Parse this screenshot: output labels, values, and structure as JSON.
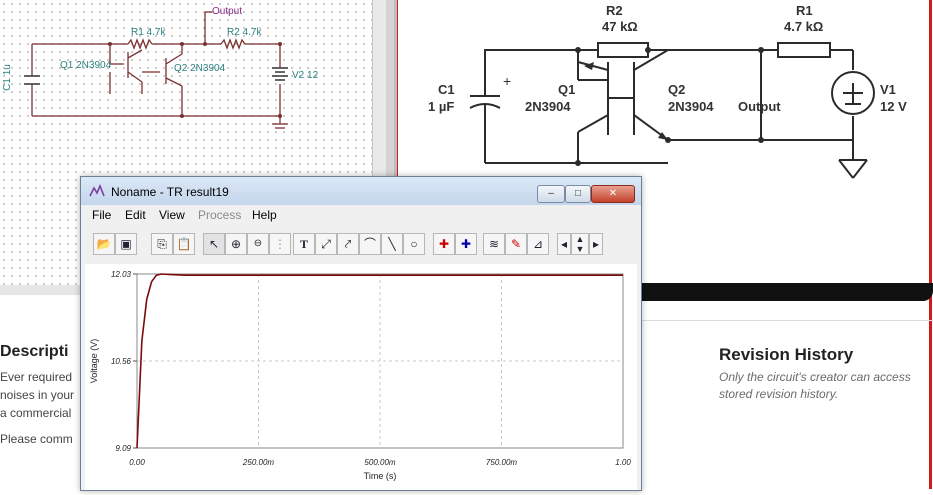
{
  "schematic_left": {
    "labels": {
      "output": "Output",
      "r1": "R1 4.7k",
      "r2": "R2 4.7k",
      "q1": "Q1 2N3904",
      "q2": "Q2 2N3904",
      "c1": "C1 1u",
      "v2": "V2 12"
    }
  },
  "schematic_right": {
    "labels": {
      "r2_name": "R2",
      "r2_value": "47 kΩ",
      "r1_name": "R1",
      "r1_value": "4.7 kΩ",
      "c1_name": "C1",
      "c1_value": "1 µF",
      "q1_name": "Q1",
      "q1_model": "2N3904",
      "q2_name": "Q2",
      "q2_model": "2N3904",
      "output": "Output",
      "v1_name": "V1",
      "v1_value": "12 V",
      "plus": "+"
    }
  },
  "description": {
    "title": "Descripti",
    "lines": [
      "Ever required",
      "noises in your",
      "a commercial",
      "Please comm"
    ]
  },
  "revision": {
    "title": "Revision History",
    "body_line1": "Only the circuit's creator can access",
    "body_line2": "stored revision history."
  },
  "window": {
    "title": "Noname - TR result19",
    "controls": {
      "minimize": "–",
      "maximize": "□",
      "close": "✕"
    },
    "menu": [
      "File",
      "Edit",
      "View",
      "Process",
      "Help"
    ],
    "menu_disabled": [
      "Process"
    ],
    "toolbar_icons": [
      "open-folder-icon",
      "save-icon",
      "copy-icon",
      "paste-icon",
      "pointer-icon",
      "zoom-in-icon",
      "zoom-100-icon",
      "grid-icon",
      "text-tool-icon",
      "cursor-a-icon",
      "cursor-b-icon",
      "function-icon",
      "line-icon",
      "circle-icon",
      "marker-a-icon",
      "marker-b-icon",
      "series-icon",
      "pen-icon",
      "curve-icon",
      "scroll-left-icon",
      "scroll-up-down-icon",
      "scroll-right-icon"
    ]
  },
  "chart_data": {
    "type": "line",
    "title": "",
    "xlabel": "Time (s)",
    "ylabel": "Voltage (V)",
    "xlim": [
      0,
      1.0
    ],
    "ylim": [
      9.09,
      12.03
    ],
    "x_ticks": [
      "0.00",
      "250.00m",
      "500.00m",
      "750.00m",
      "1.00"
    ],
    "y_ticks": [
      "9.09",
      "10.56",
      "12.03"
    ],
    "grid": true,
    "series": [
      {
        "color": "#7a0a0a",
        "x": [
          0.0,
          0.01,
          0.02,
          0.03,
          0.04,
          0.05,
          0.07,
          0.1,
          0.2,
          0.4,
          0.6,
          0.8,
          1.0
        ],
        "y": [
          9.09,
          10.9,
          11.6,
          11.9,
          12.01,
          12.03,
          12.02,
          12.01,
          12.01,
          12.01,
          12.01,
          12.01,
          12.01
        ]
      }
    ]
  }
}
